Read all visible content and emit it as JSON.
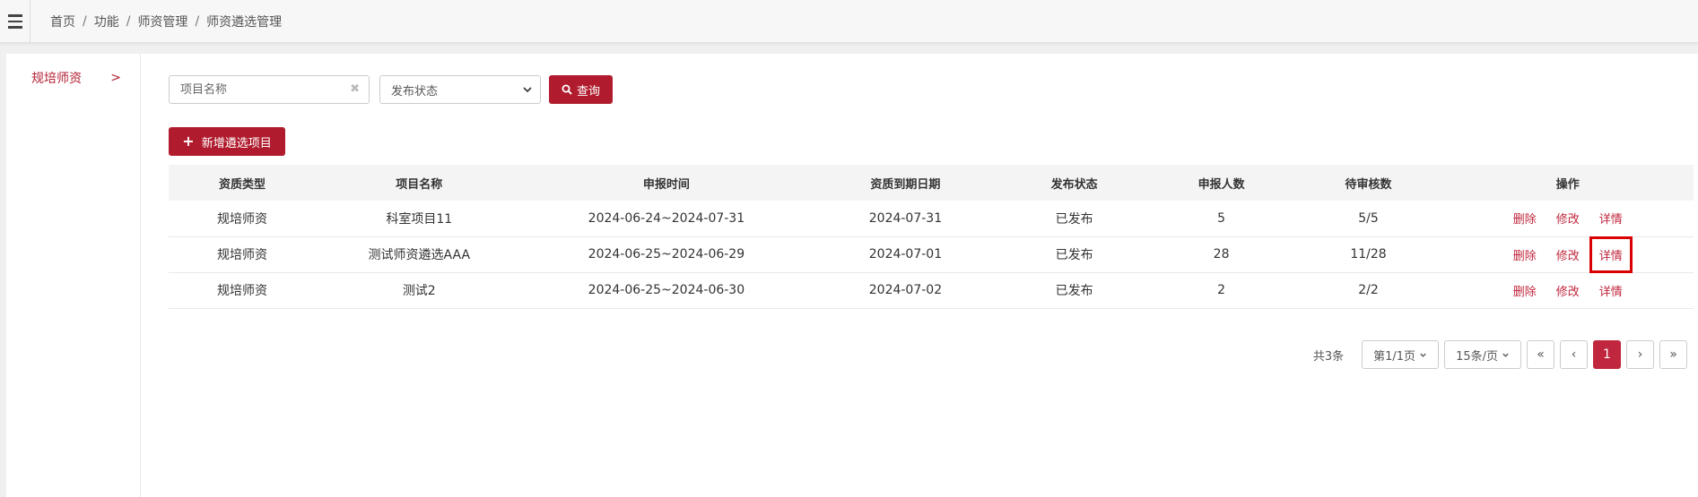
{
  "breadcrumb": [
    "首页",
    "功能",
    "师资管理",
    "师资遴选管理"
  ],
  "sidebar": {
    "item_label": "规培师资",
    "chevron": ">"
  },
  "search": {
    "project_placeholder": "项目名称",
    "clear_icon": "✖",
    "status_placeholder": "发布状态",
    "query_label": "查询"
  },
  "add_button_label": "新增遴选项目",
  "table": {
    "headers": [
      "资质类型",
      "项目名称",
      "申报时间",
      "资质到期日期",
      "发布状态",
      "申报人数",
      "待审核数",
      "操作"
    ],
    "rows": [
      [
        "规培师资",
        "科室项目11",
        "2024-06-24~2024-07-31",
        "2024-07-31",
        "已发布",
        "5",
        "5/5"
      ],
      [
        "规培师资",
        "测试师资遴选AAA",
        "2024-06-25~2024-06-29",
        "2024-07-01",
        "已发布",
        "28",
        "11/28"
      ],
      [
        "规培师资",
        "测试2",
        "2024-06-25~2024-06-30",
        "2024-07-02",
        "已发布",
        "2",
        "2/2"
      ]
    ],
    "ops": {
      "delete": "删除",
      "edit": "修改",
      "detail": "详情"
    }
  },
  "pagination": {
    "total": "共3条",
    "page_select": "第1/1页",
    "size_select": "15条/页",
    "first": "«",
    "prev": "‹",
    "current": "1",
    "next": "›",
    "last": "»"
  },
  "colors": {
    "accent": "#b01c2e",
    "link": "#c0263d",
    "highlight": "#d90000"
  }
}
